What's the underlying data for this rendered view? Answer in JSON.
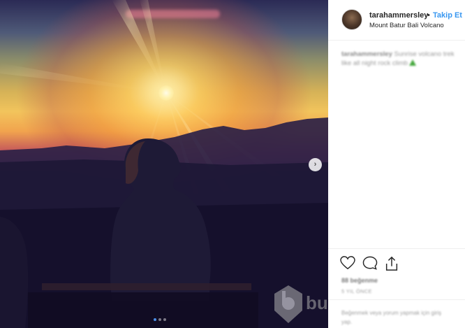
{
  "post": {
    "image_alt": "Sunrise over Mount Batur, silhouette of a woman",
    "carousel": {
      "total": 3,
      "active": 1
    }
  },
  "header": {
    "username": "tarahammersley",
    "separator": "•",
    "follow_label": "Takip Et",
    "location": "Mount Batur Bali Volcano"
  },
  "caption": {
    "user": "tarahammersley",
    "text_line1": "Sunrise volcano trek",
    "text_line2": "like all night rock climb"
  },
  "engagement": {
    "likes": "88 beğenme",
    "time": "5 YIL ÖNCE"
  },
  "comment": {
    "line1": "Beğenmek veya yorum yapmak için giriş",
    "line2": "yap."
  },
  "icons": {
    "like": "heart-icon",
    "comment": "speech-bubble-icon",
    "share": "share-icon",
    "next": "chevron-right-icon"
  },
  "colors": {
    "accent": "#3897f0",
    "text": "#262626",
    "carousel_active": "#4a8fe8"
  },
  "watermark": {
    "text": "bu"
  }
}
